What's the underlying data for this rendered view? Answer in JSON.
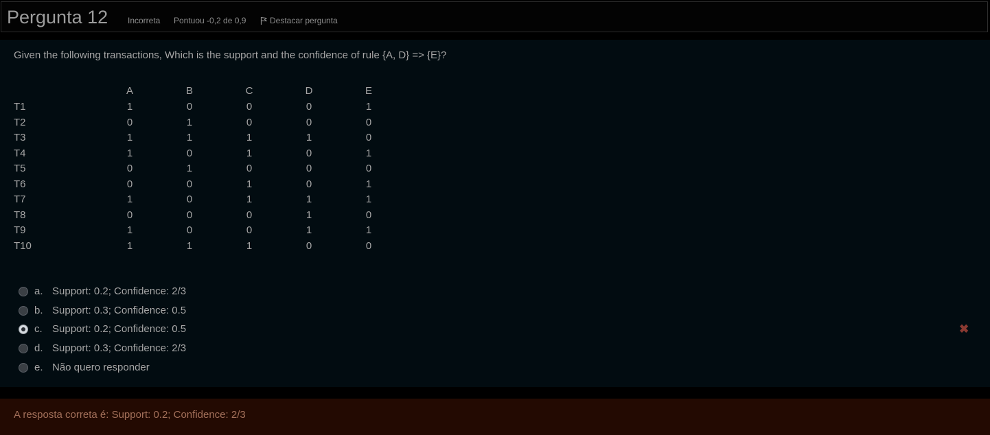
{
  "header": {
    "title": "Pergunta 12",
    "status": "Incorreta",
    "score": "Pontuou -0,2 de 0,9",
    "flag_label": "Destacar pergunta",
    "flag_icon": "flag-icon"
  },
  "question": {
    "text": "Given the following transactions, Which is the support and the confidence of rule {A, D} => {E}?",
    "table": {
      "columns": [
        "A",
        "B",
        "C",
        "D",
        "E"
      ],
      "rows": [
        {
          "label": "T1",
          "values": [
            "1",
            "0",
            "0",
            "0",
            "1"
          ]
        },
        {
          "label": "T2",
          "values": [
            "0",
            "1",
            "0",
            "0",
            "0"
          ]
        },
        {
          "label": "T3",
          "values": [
            "1",
            "1",
            "1",
            "1",
            "0"
          ]
        },
        {
          "label": "T4",
          "values": [
            "1",
            "0",
            "1",
            "0",
            "1"
          ]
        },
        {
          "label": "T5",
          "values": [
            "0",
            "1",
            "0",
            "0",
            "0"
          ]
        },
        {
          "label": "T6",
          "values": [
            "0",
            "0",
            "1",
            "0",
            "1"
          ]
        },
        {
          "label": "T7",
          "values": [
            "1",
            "0",
            "1",
            "1",
            "1"
          ]
        },
        {
          "label": "T8",
          "values": [
            "0",
            "0",
            "0",
            "1",
            "0"
          ]
        },
        {
          "label": "T9",
          "values": [
            "1",
            "0",
            "0",
            "1",
            "1"
          ]
        },
        {
          "label": "T10",
          "values": [
            "1",
            "1",
            "1",
            "0",
            "0"
          ]
        }
      ]
    },
    "options": [
      {
        "letter": "a.",
        "text": "Support: 0.2; Confidence: 2/3",
        "selected": false
      },
      {
        "letter": "b.",
        "text": "Support: 0.3; Confidence: 0.5",
        "selected": false
      },
      {
        "letter": "c.",
        "text": "Support: 0.2; Confidence: 0.5",
        "selected": true
      },
      {
        "letter": "d.",
        "text": "Support: 0.3; Confidence: 2/3",
        "selected": false
      },
      {
        "letter": "e.",
        "text": "Não quero responder",
        "selected": false
      }
    ],
    "incorrect_icon": "✖"
  },
  "feedback": {
    "text": "A resposta correta é: Support: 0.2; Confidence: 2/3"
  },
  "colors": {
    "page_bg": "#000000",
    "content_bg": "#020c11",
    "feedback_bg": "#230a02",
    "feedback_text": "#a3705a",
    "incorrect_mark": "#8a3a32"
  }
}
